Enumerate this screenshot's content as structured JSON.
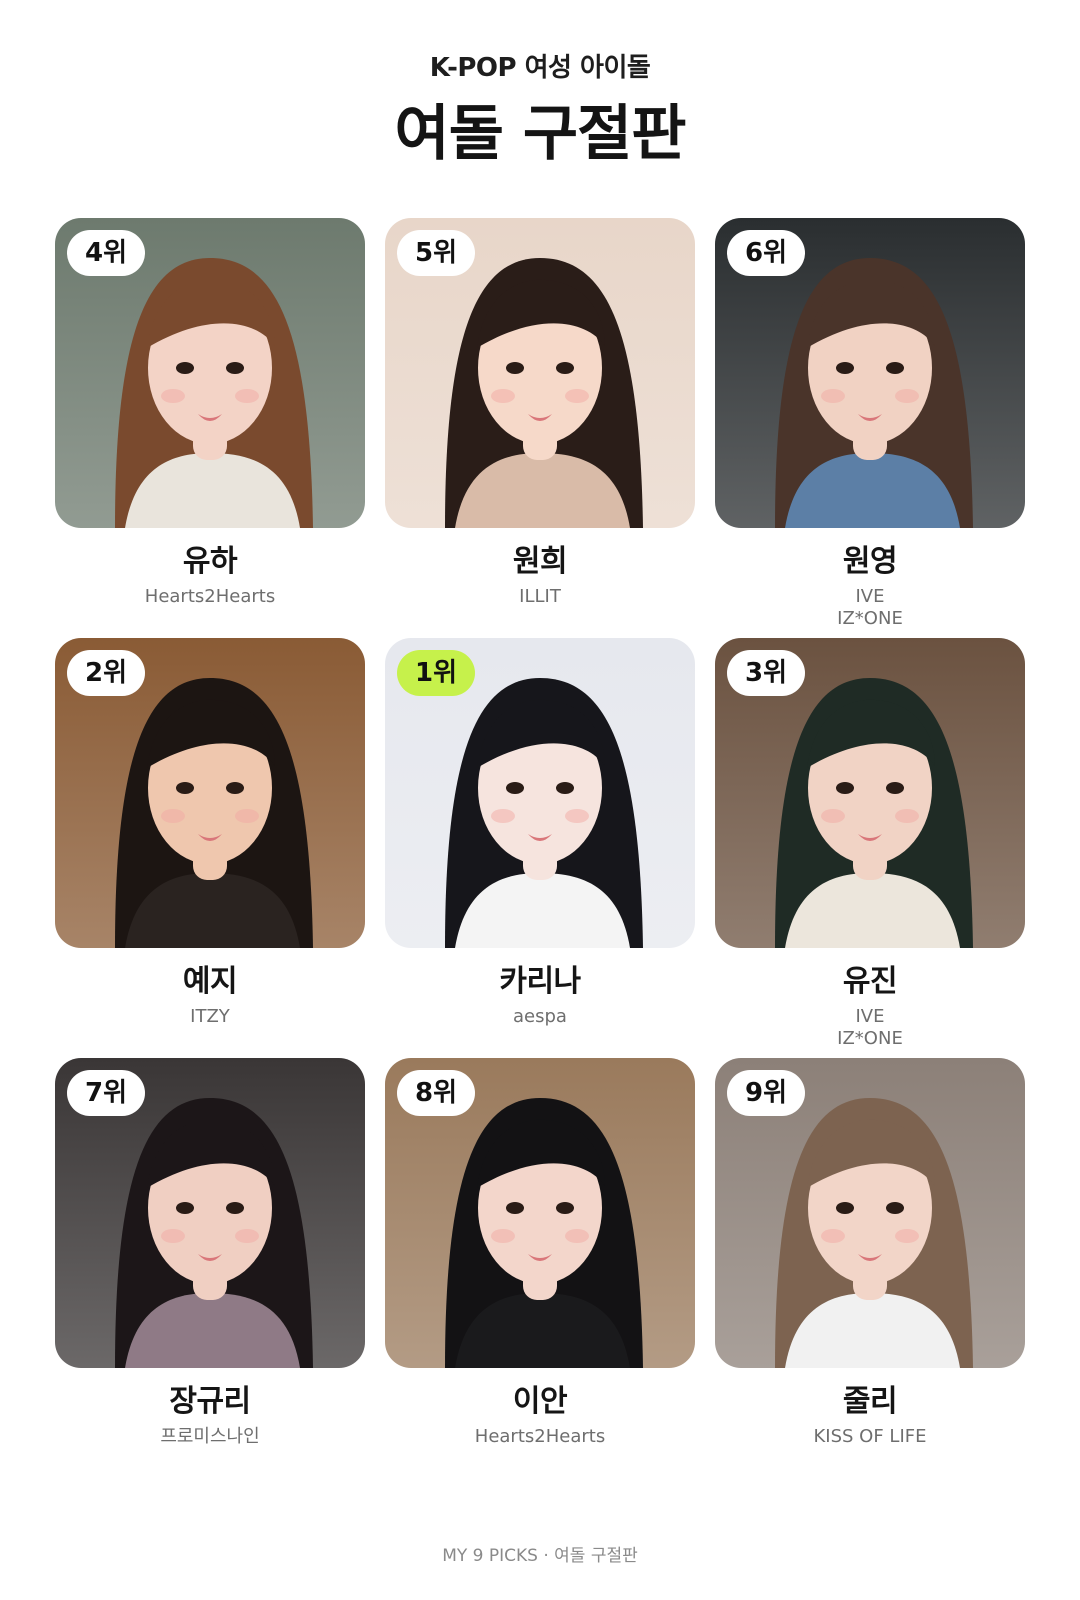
{
  "header": {
    "subtitle": "K-POP 여성 아이돌",
    "title": "여돌 구절판"
  },
  "cards": [
    {
      "rank": "4위",
      "name": "유하",
      "groups": [
        "Hearts2Hearts"
      ],
      "colors": {
        "bg": "#6d7a6e",
        "hair": "#7a4a2e",
        "skin": "#f3d3c6",
        "top": "#e9e4dc",
        "accent": "#8fd3d0"
      }
    },
    {
      "rank": "5위",
      "name": "원희",
      "groups": [
        "ILLIT"
      ],
      "colors": {
        "bg": "#e8d6c9",
        "hair": "#2a1d18",
        "skin": "#f6d9c9",
        "top": "#d9bba8",
        "accent": "#f1b7c0"
      }
    },
    {
      "rank": "6위",
      "name": "원영",
      "groups": [
        "IVE",
        "IZ*ONE"
      ],
      "colors": {
        "bg": "#2a2e30",
        "hair": "#4a342a",
        "skin": "#f1d2c3",
        "top": "#5c7fa6",
        "accent": "#f1d2c3"
      }
    },
    {
      "rank": "2위",
      "name": "예지",
      "groups": [
        "ITZY"
      ],
      "colors": {
        "bg": "#8a5b35",
        "hair": "#1c1512",
        "skin": "#efc7ae",
        "top": "#2a2320",
        "accent": "#d7c6b5"
      }
    },
    {
      "rank": "1위",
      "name": "카리나",
      "groups": [
        "aespa"
      ],
      "colors": {
        "bg": "#e6e8ee",
        "hair": "#16161b",
        "skin": "#f6e4de",
        "top": "#f4f4f4",
        "accent": "#c6f14b"
      }
    },
    {
      "rank": "3위",
      "name": "유진",
      "groups": [
        "IVE",
        "IZ*ONE"
      ],
      "colors": {
        "bg": "#6b5240",
        "hair": "#1f2b25",
        "skin": "#f1d3c5",
        "top": "#ece6dc",
        "accent": "#cfc4b8"
      }
    },
    {
      "rank": "7위",
      "name": "장규리",
      "groups": [
        "프로미스나인"
      ],
      "colors": {
        "bg": "#3a3636",
        "hair": "#1c1618",
        "skin": "#f0cfc2",
        "top": "#8f7a86",
        "accent": "#b6a1ad"
      }
    },
    {
      "rank": "8위",
      "name": "이안",
      "groups": [
        "Hearts2Hearts"
      ],
      "colors": {
        "bg": "#9a7a5c",
        "hair": "#131214",
        "skin": "#f3d6cb",
        "top": "#1a1a1c",
        "accent": "#e8c0b4"
      }
    },
    {
      "rank": "9위",
      "name": "줄리",
      "groups": [
        "KISS OF LIFE"
      ],
      "colors": {
        "bg": "#8c8078",
        "hair": "#7d6350",
        "skin": "#f2d5c8",
        "top": "#f1f1f1",
        "accent": "#1e1e1e"
      }
    }
  ],
  "footer": "MY 9 PICKS · 여돌 구절판"
}
